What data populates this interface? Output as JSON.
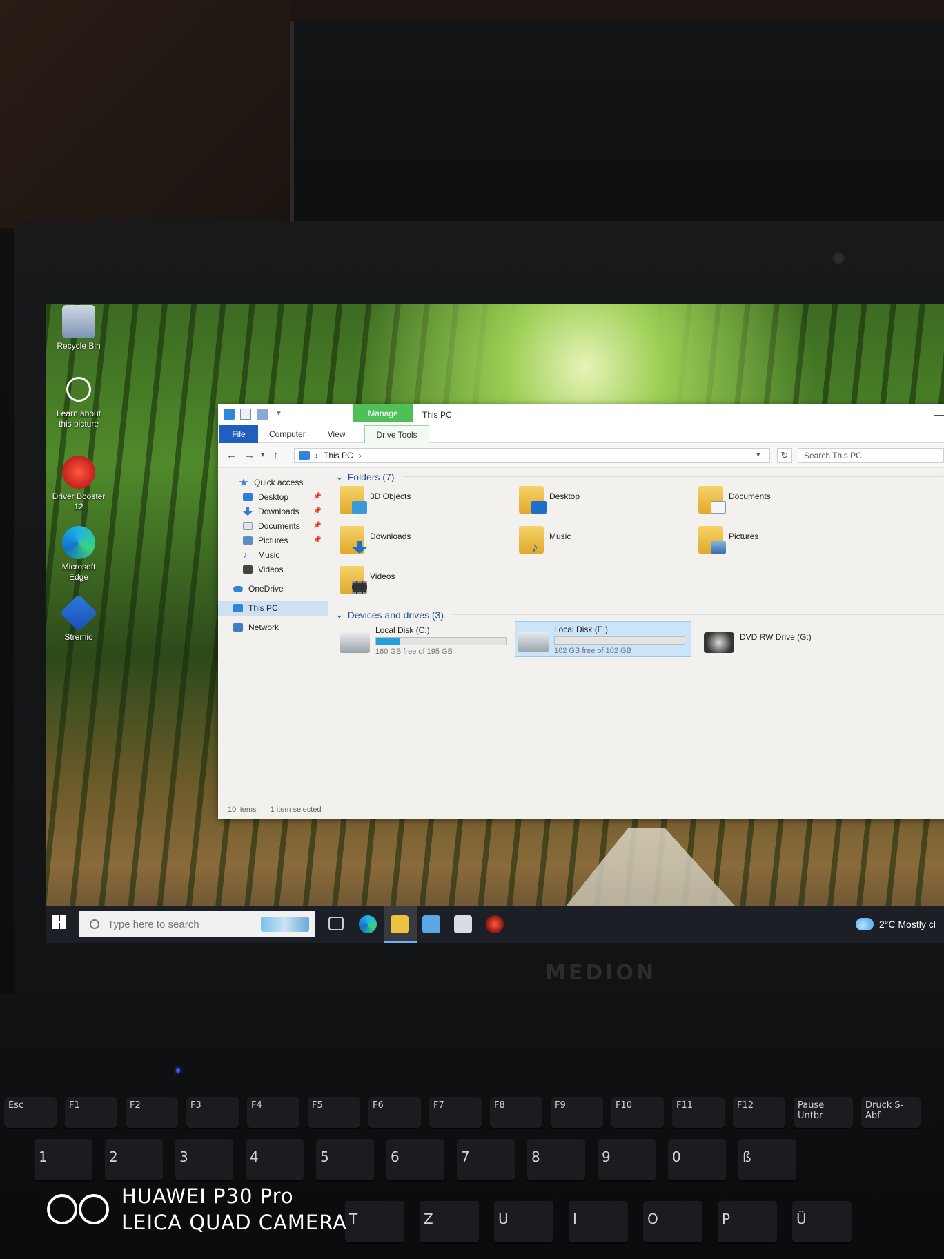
{
  "desktop": {
    "icons": [
      {
        "label": "Recycle Bin"
      },
      {
        "label": "Learn about this picture"
      },
      {
        "label": "Driver Booster 12"
      },
      {
        "label": "Microsoft Edge"
      },
      {
        "label": "Stremio"
      }
    ]
  },
  "explorer": {
    "manage_tab": "Manage",
    "title": "This PC",
    "ribbon_tabs": [
      "File",
      "Computer",
      "View",
      "Drive Tools"
    ],
    "address": {
      "path": "This PC",
      "search_placeholder": "Search This PC"
    },
    "nav": {
      "quick_access": "Quick access",
      "items": [
        "Desktop",
        "Downloads",
        "Documents",
        "Pictures",
        "Music",
        "Videos"
      ],
      "onedrive": "OneDrive",
      "this_pc": "This PC",
      "network": "Network"
    },
    "folders_header": "Folders (7)",
    "folders": [
      "3D Objects",
      "Desktop",
      "Documents",
      "Downloads",
      "Music",
      "Pictures",
      "Videos"
    ],
    "drives_header": "Devices and drives (3)",
    "drives": [
      {
        "name": "Local Disk (C:)",
        "free": "160 GB free of 195 GB",
        "used_fraction": 0.18
      },
      {
        "name": "Local Disk (E:)",
        "free": "102 GB free of 102 GB",
        "used_fraction": 0.0
      },
      {
        "name": "DVD RW Drive (G:)"
      }
    ],
    "status": {
      "items": "10 items",
      "selected": "1 item selected"
    }
  },
  "taskbar": {
    "search_placeholder": "Type here to search",
    "weather": "2°C  Mostly cl"
  },
  "laptop": {
    "brand": "MEDION"
  },
  "keyboard": {
    "fn_row": [
      "Esc",
      "F1",
      "F2",
      "F3",
      "F4",
      "F5",
      "F6",
      "F7",
      "F8",
      "F9",
      "F10",
      "F11",
      "F12",
      "Pause Untbr",
      "Druck S-Abf"
    ],
    "num_row": [
      "1",
      "2",
      "3",
      "4",
      "5",
      "6",
      "7",
      "8",
      "9",
      "0",
      "ß"
    ],
    "letter_row": [
      "T",
      "Z",
      "U",
      "I",
      "O",
      "P",
      "Ü"
    ]
  },
  "watermark": {
    "line1": "HUAWEI P30 Pro",
    "line2": "LEICA QUAD CAMERA"
  }
}
